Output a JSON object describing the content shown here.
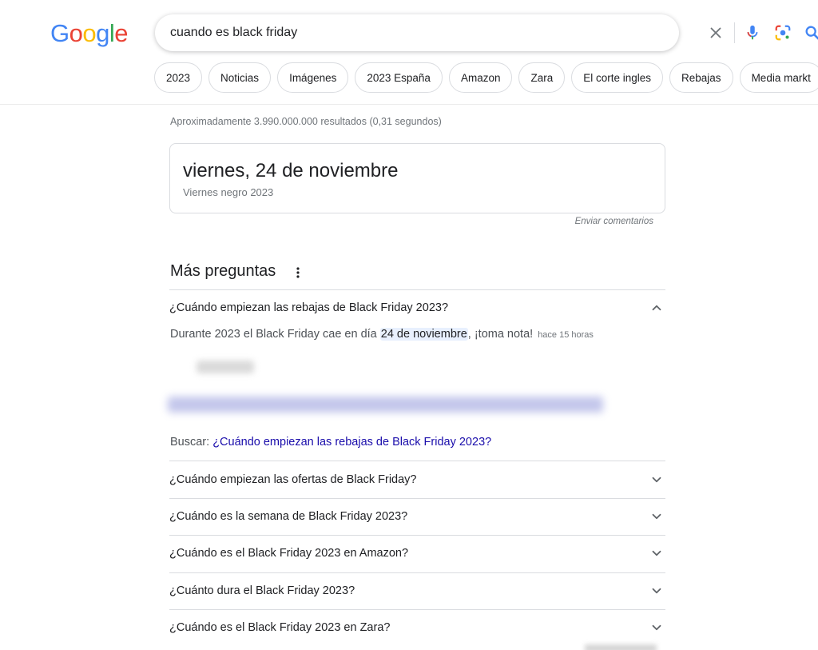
{
  "logo": {
    "letters": [
      "G",
      "o",
      "o",
      "g",
      "l",
      "e"
    ],
    "colors": [
      "#4285F4",
      "#EA4335",
      "#FBBC05",
      "#4285F4",
      "#34A853",
      "#EA4335"
    ]
  },
  "search": {
    "query": "cuando es black friday",
    "clear_icon": "close-icon",
    "voice_icon": "mic-icon",
    "lens_icon": "camera-lens-icon",
    "submit_icon": "search-icon"
  },
  "chips": [
    "2023",
    "Noticias",
    "Imágenes",
    "2023 España",
    "Amazon",
    "Zara",
    "El corte ingles",
    "Rebajas",
    "Media markt"
  ],
  "stats": "Aproximadamente 3.990.000.000 resultados (0,31 segundos)",
  "featured_answer": {
    "main": "viernes, 24 de noviembre",
    "sub": "Viernes negro 2023",
    "feedback": "Enviar comentarios"
  },
  "paa": {
    "title": "Más preguntas",
    "expanded": {
      "question": "¿Cuándo empiezan las rebajas de Black Friday 2023?",
      "answer_before": "Durante 2023 el Black Friday cae en día ",
      "answer_highlight": "24 de noviembre",
      "answer_after": ", ¡toma nota!",
      "age": "hace 15 horas",
      "search_prefix": "Buscar: ",
      "search_link": "¿Cuándo empiezan las rebajas de Black Friday 2023?"
    },
    "questions": [
      "¿Cuándo empiezan las ofertas de Black Friday?",
      "¿Cuándo es la semana de Black Friday 2023?",
      "¿Cuándo es el Black Friday 2023 en Amazon?",
      "¿Cuánto dura el Black Friday 2023?",
      "¿Cuándo es el Black Friday 2023 en Zara?"
    ]
  },
  "colors": {
    "link": "#1a0dab",
    "accent_blue": "#4285F4",
    "highlight": "#e8f0fe",
    "muted_text": "#70757a"
  }
}
